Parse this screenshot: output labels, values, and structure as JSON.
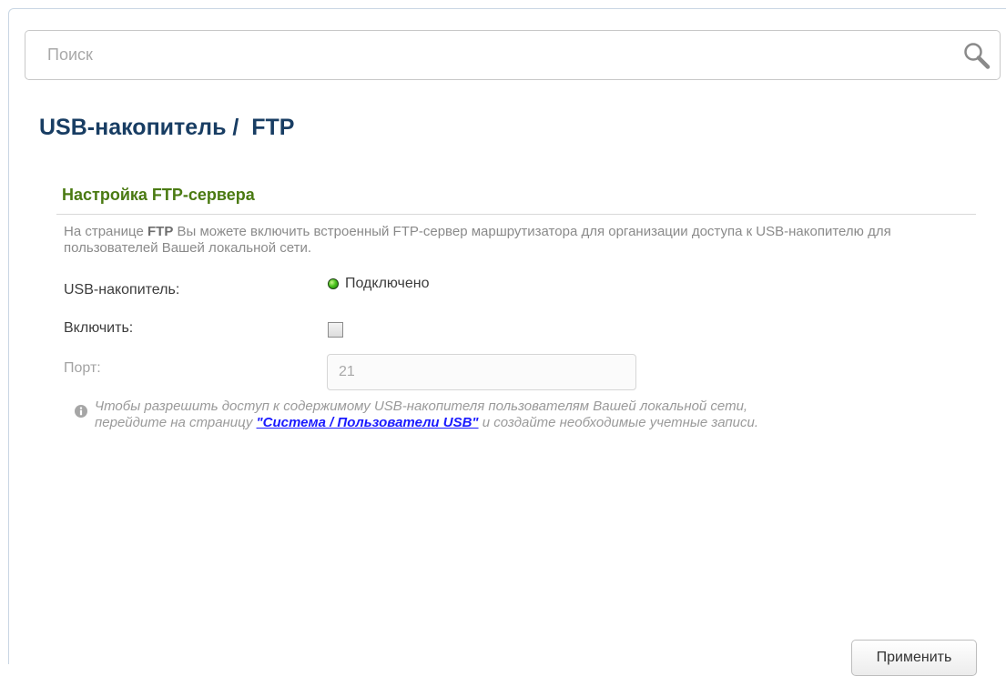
{
  "search": {
    "placeholder": "Поиск",
    "value": ""
  },
  "header": {
    "title": "USB-накопитель /  FTP"
  },
  "section": {
    "title": "Настройка FTP-сервера",
    "description_prefix": "На странице ",
    "description_bold": "FTP",
    "description_rest": " Вы можете включить встроенный FTP-сервер маршрутизатора для организации доступа к USB-накопителю для пользователей Вашей локальной сети."
  },
  "fields": {
    "usb_label": "USB-накопитель:",
    "usb_status": "Подключено",
    "usb_status_color": "#48c31b",
    "enable_label": "Включить:",
    "enable_checked": false,
    "port_label": "Порт:",
    "port_value": "21"
  },
  "note": {
    "icon": "info-icon",
    "text_before": "Чтобы разрешить доступ к содержимому USB-накопителя пользователям Вашей локальной сети, перейдите на страницу ",
    "link": "\"Система / Пользователи USB\"",
    "text_after": " и создайте необходимые учетные записи."
  },
  "actions": {
    "apply_label": "Применить"
  },
  "colors": {
    "title": "#183d63",
    "section": "#4a7a12",
    "link": "#1a1aff"
  }
}
